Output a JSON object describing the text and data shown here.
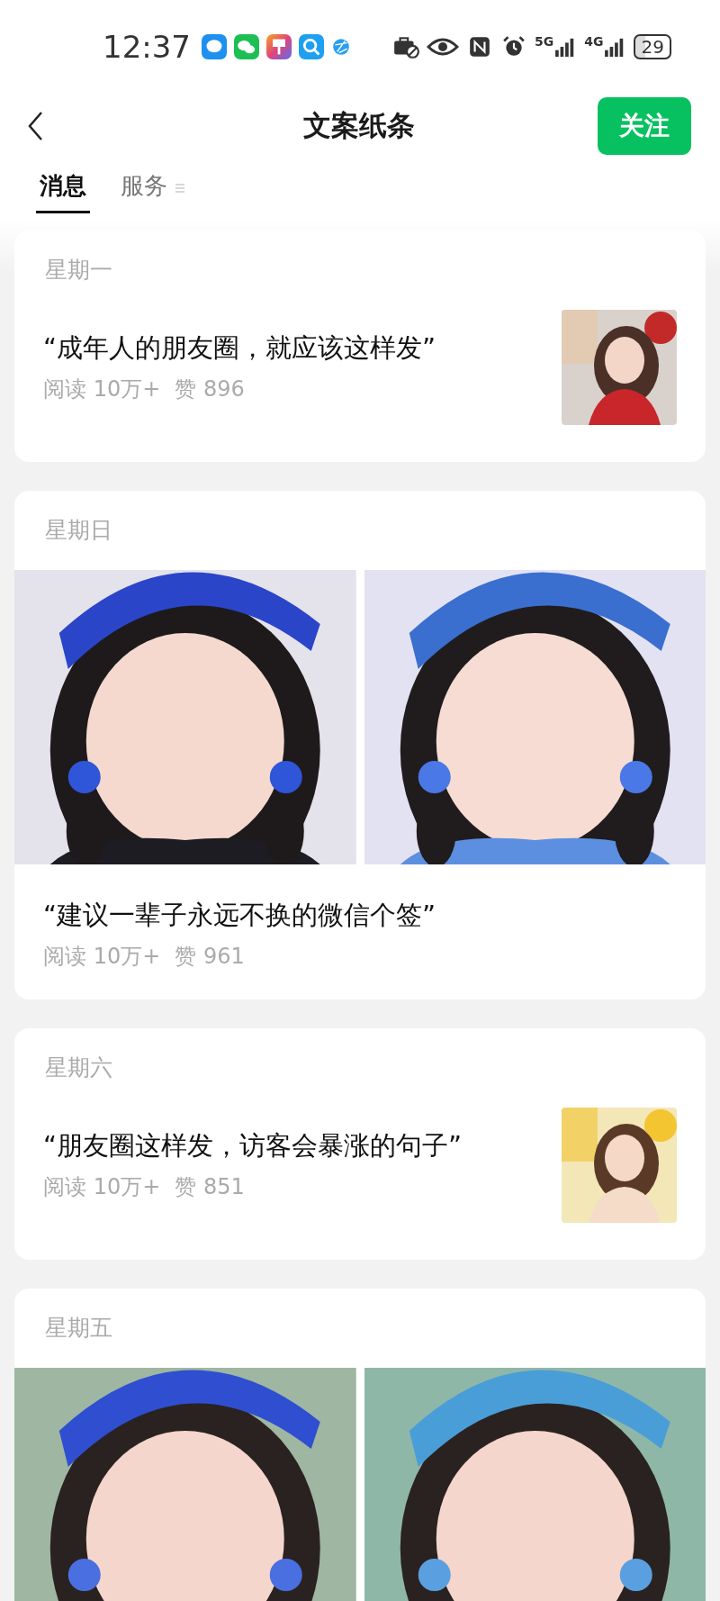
{
  "status_bar": {
    "time": "12:37",
    "network_5g": "5G",
    "network_4g": "4G",
    "battery": "29"
  },
  "header": {
    "title": "文案纸条",
    "follow_button": "关注"
  },
  "tabs": [
    {
      "label": "消息",
      "selected": true
    },
    {
      "label": "服务",
      "selected": false
    }
  ],
  "posts": [
    {
      "kind": "single",
      "day": "星期一",
      "title": "“成年人的朋友圈，就应该这样发”",
      "reads": "阅读 10万+",
      "likes": "赞 896"
    },
    {
      "kind": "gallery",
      "day": "星期日",
      "title": "“建议一辈子永远不换的微信个签”",
      "reads": "阅读 10万+",
      "likes": "赞 961"
    },
    {
      "kind": "single",
      "day": "星期六",
      "title": "“朋友圈这样发，访客会暴涨的句子”",
      "reads": "阅读 10万+",
      "likes": "赞 851"
    },
    {
      "kind": "gallery",
      "day": "星期五"
    }
  ]
}
